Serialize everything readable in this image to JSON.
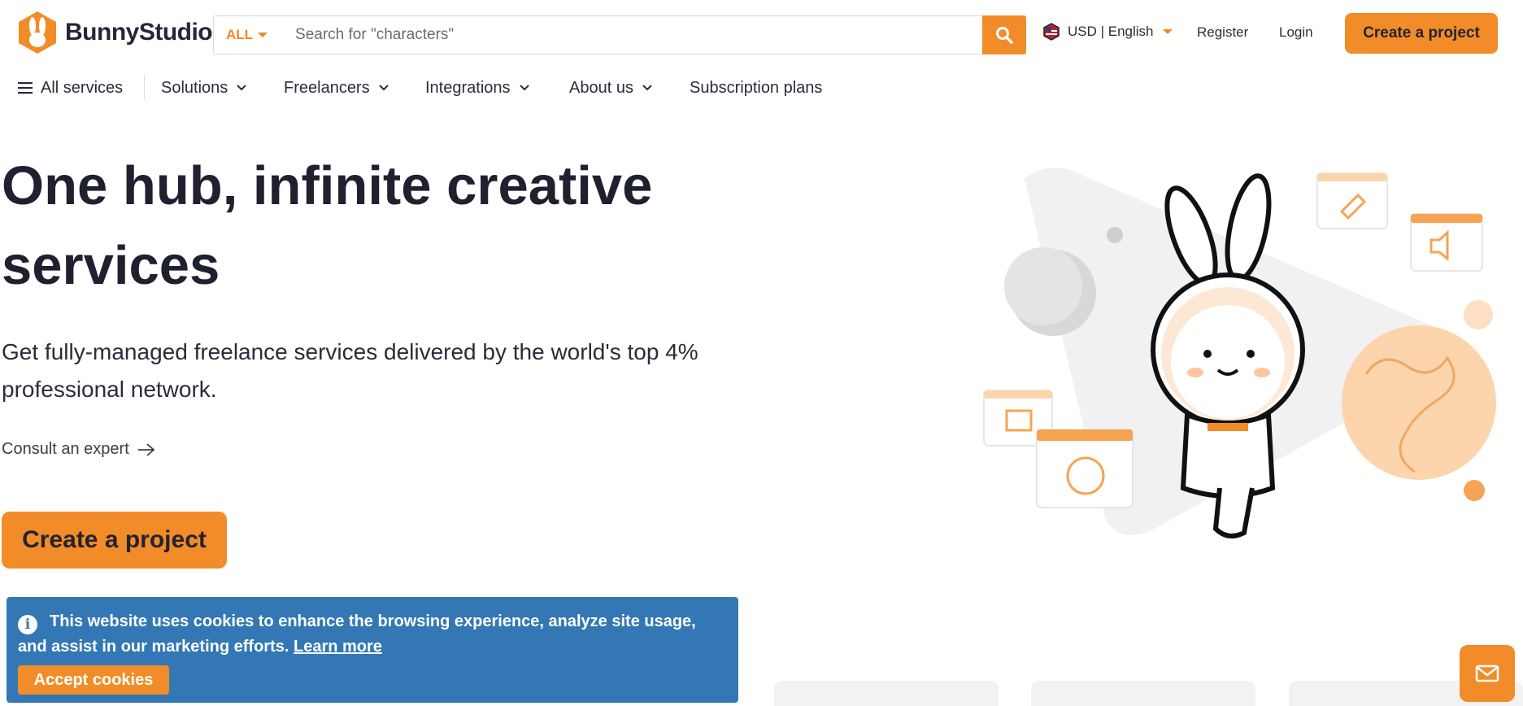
{
  "brand": {
    "name": "BunnyStudio",
    "accent": "#f28c28",
    "dark": "#1f2030",
    "cookie_bg": "#3378b4"
  },
  "search": {
    "scope": "ALL",
    "placeholder": "Search for \"characters\""
  },
  "header": {
    "currency_language": "USD | English",
    "register": "Register",
    "login": "Login",
    "create_project": "Create a project"
  },
  "subnav": {
    "all_services": "All services",
    "solutions": "Solutions",
    "freelancers": "Freelancers",
    "integrations": "Integrations",
    "about_us": "About us",
    "subscription_plans": "Subscription plans"
  },
  "hero": {
    "title": "One hub, infinite creative services",
    "subtitle": "Get fully-managed freelance services delivered by the world's top 4% professional network.",
    "consult": "Consult an expert",
    "cta": "Create a project"
  },
  "cookie": {
    "message": "This website uses cookies to enhance the browsing experience, analyze site usage, and assist in our marketing efforts.",
    "learn_more": "Learn more",
    "accept": "Accept cookies"
  },
  "icons": [
    "logo-bunny-icon",
    "search-icon",
    "us-flag-icon",
    "hamburger-icon",
    "chevron-down-icon",
    "arrow-right-icon",
    "info-icon",
    "mail-icon"
  ]
}
